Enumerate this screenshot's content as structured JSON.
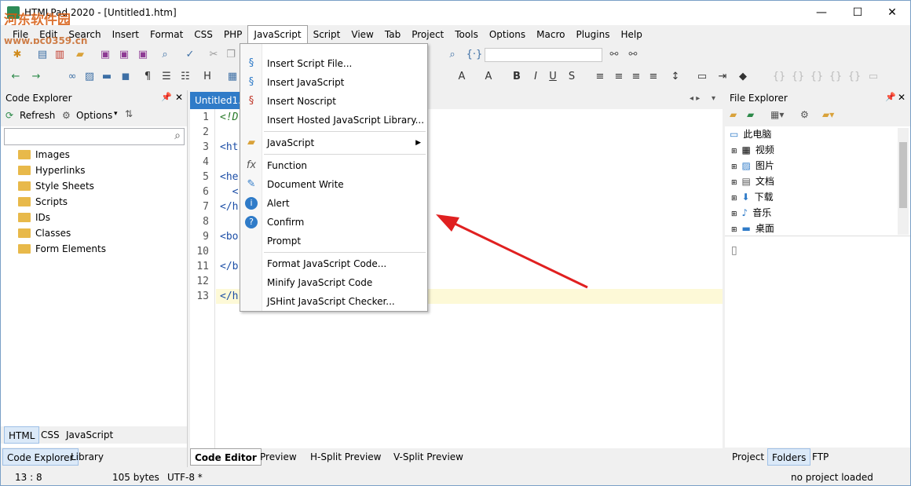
{
  "window": {
    "title": "HTMLPad 2020 - [Untitled1.htm]",
    "watermark_top": "河东软件园",
    "watermark_url": "www.pc0359.cn",
    "controls": [
      "—",
      "☐",
      "✕"
    ]
  },
  "menubar": [
    "File",
    "Edit",
    "Search",
    "Insert",
    "Format",
    "CSS",
    "PHP",
    "JavaScript",
    "Script",
    "View",
    "Tab",
    "Project",
    "Tools",
    "Options",
    "Macro",
    "Plugins",
    "Help"
  ],
  "active_menu": "JavaScript",
  "js_menu": {
    "items": [
      {
        "label": "Insert Script File...",
        "icon": "script-icon"
      },
      {
        "label": "Insert JavaScript",
        "icon": "script-icon"
      },
      {
        "label": "Insert Noscript",
        "icon": "script-no-icon"
      },
      {
        "label": "Insert Hosted JavaScript Library...",
        "icon": ""
      },
      {
        "label": "JavaScript",
        "icon": "folder-icon",
        "submenu": true
      },
      {
        "label": "Function",
        "icon": "fx-icon"
      },
      {
        "label": "Document Write",
        "icon": "pencil-icon"
      },
      {
        "label": "Alert",
        "icon": "info-icon"
      },
      {
        "label": "Confirm",
        "icon": "question-icon"
      },
      {
        "label": "Prompt",
        "icon": ""
      },
      {
        "label": "Format JavaScript Code...",
        "icon": ""
      },
      {
        "label": "Minify JavaScript Code",
        "icon": ""
      },
      {
        "label": "JSHint JavaScript Checker...",
        "icon": ""
      }
    ]
  },
  "code_explorer": {
    "title": "Code Explorer",
    "refresh": "Refresh",
    "options": "Options",
    "items": [
      "Images",
      "Hyperlinks",
      "Style Sheets",
      "Scripts",
      "IDs",
      "Classes",
      "Form Elements"
    ],
    "lang_tabs": [
      "HTML",
      "CSS",
      "JavaScript"
    ],
    "bottom_tabs": [
      "Code Explorer",
      "Library"
    ]
  },
  "editor": {
    "tab_label": "Untitled1.h",
    "line_numbers": [
      "1",
      "2",
      "3",
      "4",
      "5",
      "6",
      "7",
      "8",
      "9",
      "10",
      "11",
      "12",
      "13"
    ],
    "lines": [
      "<!D",
      "",
      "<ht",
      "",
      "<he",
      "  <",
      "</h",
      "",
      "<bo",
      "",
      "</b",
      "",
      "</h"
    ],
    "view_tabs": [
      "Code Editor",
      "Preview",
      "H-Split Preview",
      "V-Split Preview"
    ]
  },
  "file_explorer": {
    "title": "File Explorer",
    "items": [
      "此电脑",
      "视频",
      "图片",
      "文档",
      "下载",
      "音乐",
      "桌面"
    ],
    "bottom_tabs": [
      "Project",
      "Folders",
      "FTP"
    ]
  },
  "statusbar": {
    "position": "13 : 8",
    "size": "105 bytes",
    "encoding": "UTF-8 *",
    "project": "no project loaded"
  },
  "colors": {
    "accent": "#2f7bc8",
    "arrow": "#e02020",
    "current_line": "#fdf9d7"
  }
}
